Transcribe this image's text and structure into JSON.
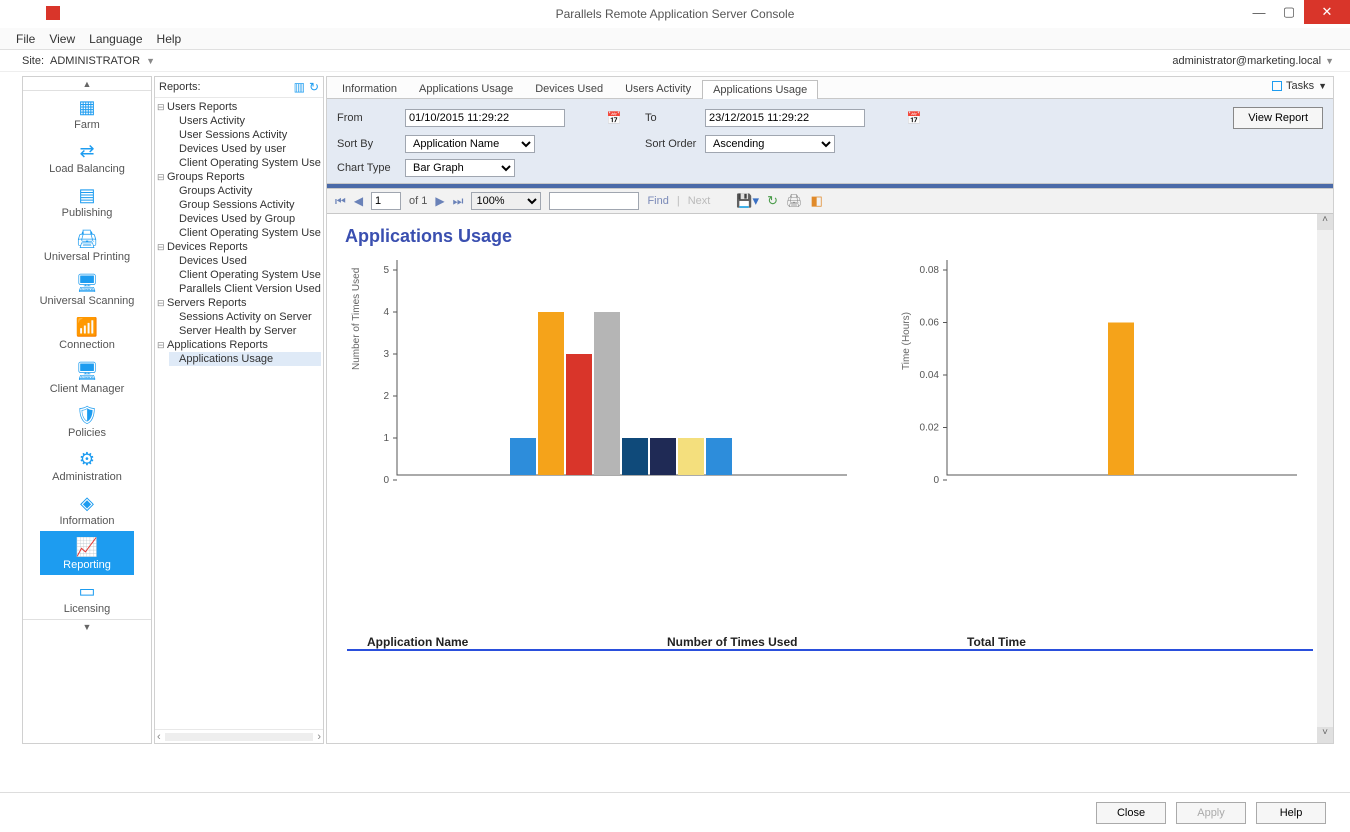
{
  "window": {
    "title": "Parallels Remote Application Server Console"
  },
  "menu": {
    "items": [
      "File",
      "View",
      "Language",
      "Help"
    ]
  },
  "site": {
    "label": "Site:",
    "value": "ADMINISTRATOR",
    "user": "administrator@marketing.local"
  },
  "leftnav": {
    "items": [
      {
        "label": "Farm"
      },
      {
        "label": "Load Balancing"
      },
      {
        "label": "Publishing"
      },
      {
        "label": "Universal Printing"
      },
      {
        "label": "Universal Scanning"
      },
      {
        "label": "Connection"
      },
      {
        "label": "Client Manager"
      },
      {
        "label": "Policies"
      },
      {
        "label": "Administration"
      },
      {
        "label": "Information"
      },
      {
        "label": "Reporting",
        "active": true
      },
      {
        "label": "Licensing"
      }
    ]
  },
  "tree": {
    "header": "Reports:",
    "groups": [
      {
        "label": "Users Reports",
        "children": [
          "Users Activity",
          "User Sessions Activity",
          "Devices Used by user",
          "Client Operating System Use"
        ]
      },
      {
        "label": "Groups Reports",
        "children": [
          "Groups Activity",
          "Group Sessions Activity",
          "Devices Used by Group",
          "Client Operating System Use"
        ]
      },
      {
        "label": "Devices Reports",
        "children": [
          "Devices Used",
          "Client Operating System Use",
          "Parallels Client Version Used"
        ]
      },
      {
        "label": "Servers Reports",
        "children": [
          "Sessions Activity on Server",
          "Server Health by Server"
        ]
      },
      {
        "label": "Applications Reports",
        "children": [
          "Applications Usage"
        ],
        "selected_child": "Applications Usage"
      }
    ]
  },
  "tabs": {
    "items": [
      "Information",
      "Applications Usage",
      "Devices Used",
      "Users Activity",
      "Applications Usage"
    ],
    "active": 4,
    "tasks_label": "Tasks"
  },
  "filters": {
    "from_label": "From",
    "from_value": "01/10/2015 11:29:22",
    "to_label": "To",
    "to_value": "23/12/2015 11:29:22",
    "sortby_label": "Sort By",
    "sortby_value": "Application Name",
    "sortorder_label": "Sort Order",
    "sortorder_value": "Ascending",
    "charttype_label": "Chart Type",
    "charttype_value": "Bar Graph",
    "view_report": "View Report"
  },
  "reportbar": {
    "page": "1",
    "of_label": "of 1",
    "zoom": "100%",
    "find_label": "Find",
    "next_label": "Next"
  },
  "report": {
    "title": "Applications Usage",
    "table_headers": [
      "Application Name",
      "Number of Times Used",
      "Total Time"
    ]
  },
  "chart_data": [
    {
      "type": "bar",
      "ylabel": "Number of Times Used",
      "ylim": [
        0,
        5
      ],
      "ticks": [
        0,
        1,
        2,
        3,
        4,
        5
      ],
      "series": [
        {
          "name": "apps",
          "values": [
            1,
            4,
            3,
            4,
            1,
            1,
            1,
            1
          ]
        }
      ],
      "colors": [
        "#2d8ddb",
        "#f5a31a",
        "#d9352a",
        "#b5b5b5",
        "#0f4a7a",
        "#1f2a55",
        "#f4df7d",
        "#2d8ddb"
      ]
    },
    {
      "type": "bar",
      "ylabel": "Time (Hours)",
      "ylim": [
        0,
        0.08
      ],
      "ticks": [
        0,
        0.02,
        0.04,
        0.06,
        0.08
      ],
      "series": [
        {
          "name": "time",
          "values": [
            0.06
          ]
        }
      ],
      "colors": [
        "#f5a31a"
      ]
    }
  ],
  "footer": {
    "close": "Close",
    "apply": "Apply",
    "help": "Help"
  }
}
